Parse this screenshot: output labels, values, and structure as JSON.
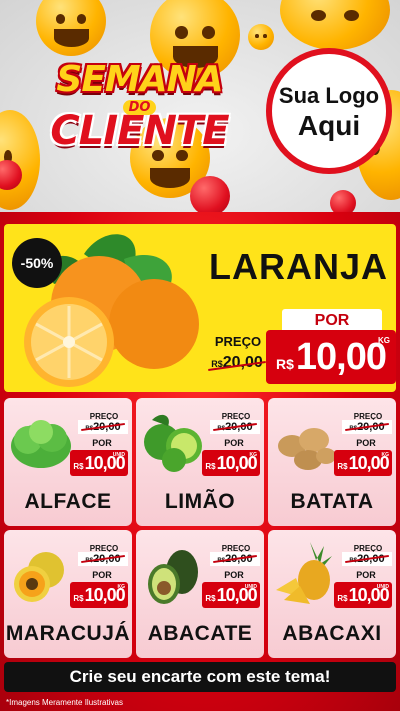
{
  "hero": {
    "title_line1": "SEMANA",
    "title_line2": "DO",
    "title_line3": "CLIENTE",
    "logo_line1": "Sua Logo",
    "logo_line2": "Aqui"
  },
  "feature": {
    "discount": "-50%",
    "name": "LARANJA",
    "preco_label": "PREÇO",
    "old_currency": "R$",
    "old_value": "20,00",
    "por_label": "POR",
    "currency": "R$",
    "value": "10,00",
    "unit": "KG"
  },
  "products": [
    {
      "name": "ALFACE",
      "preco_label": "PREÇO",
      "old_currency": "R$",
      "old_value": "20,00",
      "por_label": "POR",
      "currency": "R$",
      "value": "10,00",
      "unit": "UNID"
    },
    {
      "name": "LIMÃO",
      "preco_label": "PREÇO",
      "old_currency": "R$",
      "old_value": "20,00",
      "por_label": "POR",
      "currency": "R$",
      "value": "10,00",
      "unit": "KG"
    },
    {
      "name": "BATATA",
      "preco_label": "PREÇO",
      "old_currency": "R$",
      "old_value": "20,00",
      "por_label": "POR",
      "currency": "R$",
      "value": "10,00",
      "unit": "KG"
    },
    {
      "name": "MARACUJÁ",
      "preco_label": "PREÇO",
      "old_currency": "R$",
      "old_value": "20,00",
      "por_label": "POR",
      "currency": "R$",
      "value": "10,00",
      "unit": "KG"
    },
    {
      "name": "ABACATE",
      "preco_label": "PREÇO",
      "old_currency": "R$",
      "old_value": "20,00",
      "por_label": "POR",
      "currency": "R$",
      "value": "10,00",
      "unit": "UNID"
    },
    {
      "name": "ABACAXI",
      "preco_label": "PREÇO",
      "old_currency": "R$",
      "old_value": "20,00",
      "por_label": "POR",
      "currency": "R$",
      "value": "10,00",
      "unit": "UNID"
    }
  ],
  "cta": "Crie seu encarte com este tema!",
  "footnote": "*Imagens Meramente Ilustrativas",
  "colors": {
    "red": "#d6000e",
    "yellow": "#ffe31a",
    "card_pink": "#fde4e8",
    "dark": "#111111"
  }
}
